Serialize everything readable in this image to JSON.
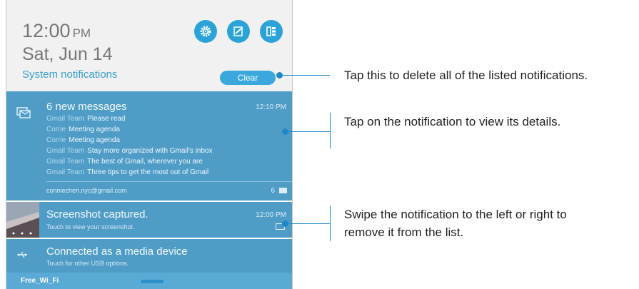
{
  "header": {
    "time": "12:00",
    "ampm": "PM",
    "date": "Sat, Jun 14",
    "section_label": "System notifications",
    "clear_label": "Clear",
    "quick_icons": [
      "settings-icon",
      "edit-icon",
      "apps-grid-icon"
    ]
  },
  "notifications": [
    {
      "title": "6 new messages",
      "time": "12:10 PM",
      "icon": "mail-stack-icon",
      "messages": [
        {
          "sender": "Gmail Team",
          "subject": "Please read"
        },
        {
          "sender": "Corrie",
          "subject": "Meeting agenda"
        },
        {
          "sender": "Corrie",
          "subject": "Meeting agenda"
        },
        {
          "sender": "Gmail Team",
          "subject": "Stay more organized with Gmail's inbox"
        },
        {
          "sender": "Gmail Team",
          "subject": "The best of Gmail, wherever you are"
        },
        {
          "sender": "Gmail Team",
          "subject": "Three tips to get the most out of Gmail"
        }
      ],
      "account": "conniechen.nyc@gmail.com",
      "count": "6"
    },
    {
      "title": "Screenshot captured.",
      "subtitle": "Touch to view your screenshot.",
      "time": "12:00 PM",
      "icon": "screenshot-thumbnail"
    },
    {
      "title": "Connected as a media device",
      "subtitle": "Touch for other USB options.",
      "icon": "usb-icon"
    }
  ],
  "bottom_bar": {
    "network": "Free_Wi_Fi"
  },
  "callouts": [
    "Tap this to delete all of the listed notifications.",
    "Tap on the notification to view its details.",
    "Swipe the notification to the left or right to remove it from the list."
  ],
  "colors": {
    "accent": "#2ba3d8",
    "notification_bg": "#4f9dc7",
    "callout_line": "#1e88c7"
  }
}
